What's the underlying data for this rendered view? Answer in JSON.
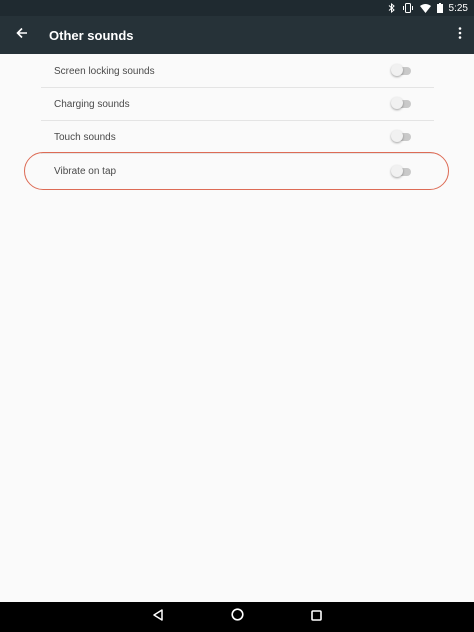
{
  "status_bar": {
    "time": "5:25",
    "icons": [
      "bluetooth-icon",
      "vibrate-icon",
      "wifi-icon",
      "battery-icon"
    ]
  },
  "app_bar": {
    "title": "Other sounds",
    "back_icon": "arrow-back-icon",
    "menu_icon": "more-vert-icon"
  },
  "settings": [
    {
      "label": "Screen locking sounds",
      "enabled": false
    },
    {
      "label": "Charging sounds",
      "enabled": false
    },
    {
      "label": "Touch sounds",
      "enabled": false
    },
    {
      "label": "Vibrate on tap",
      "enabled": false,
      "highlighted": true
    }
  ],
  "nav_bar": {
    "icons": [
      "back-triangle-icon",
      "home-circle-icon",
      "recents-square-icon"
    ]
  },
  "colors": {
    "status_bar": "#1f2a30",
    "app_bar": "#263238",
    "background": "#fafafa",
    "highlight": "#dd6b55",
    "nav_bar": "#000000"
  }
}
